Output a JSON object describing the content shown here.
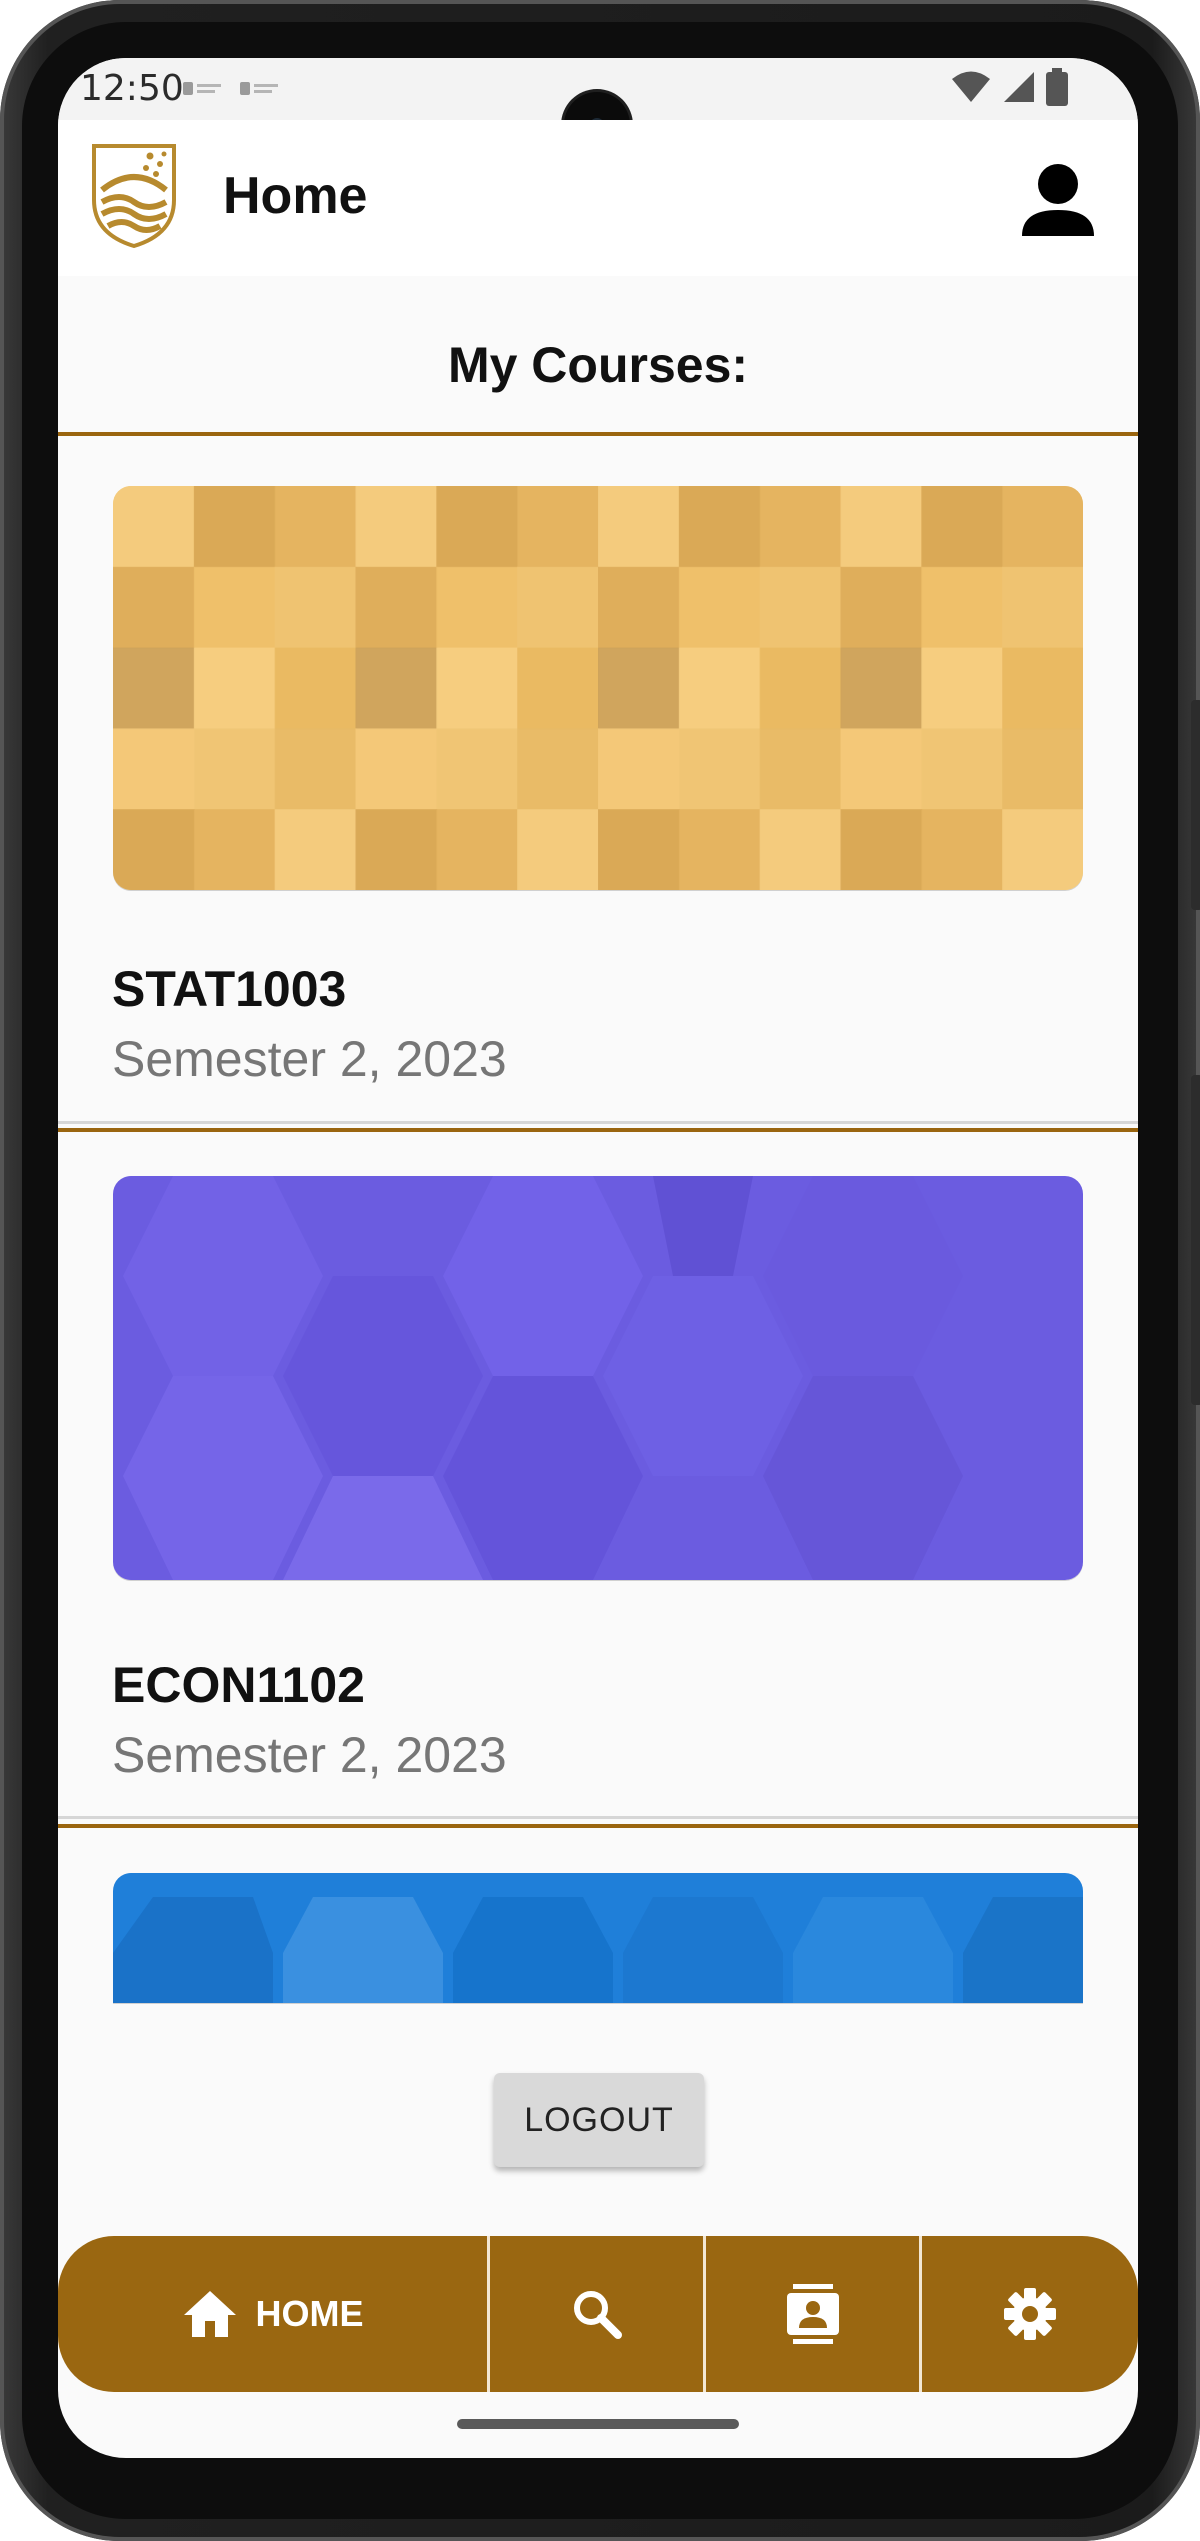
{
  "status_bar": {
    "time": "12:50"
  },
  "app_bar": {
    "title": "Home"
  },
  "section": {
    "title": "My Courses:"
  },
  "courses": [
    {
      "code": "STAT1003",
      "term": "Semester 2, 2023"
    },
    {
      "code": "ECON1102",
      "term": "Semester 2, 2023"
    }
  ],
  "logout": {
    "label": "LOGOUT"
  },
  "bottom_nav": {
    "items": [
      {
        "label": "HOME",
        "icon": "home-icon"
      },
      {
        "label": "",
        "icon": "search-icon"
      },
      {
        "label": "",
        "icon": "contacts-icon"
      },
      {
        "label": "",
        "icon": "settings-icon"
      }
    ]
  },
  "colors": {
    "accent": "#9a6711",
    "divider": "#9a650f",
    "course1": "#f2c46e",
    "course2": "#6b5ce0",
    "course3": "#1f7fd9"
  }
}
